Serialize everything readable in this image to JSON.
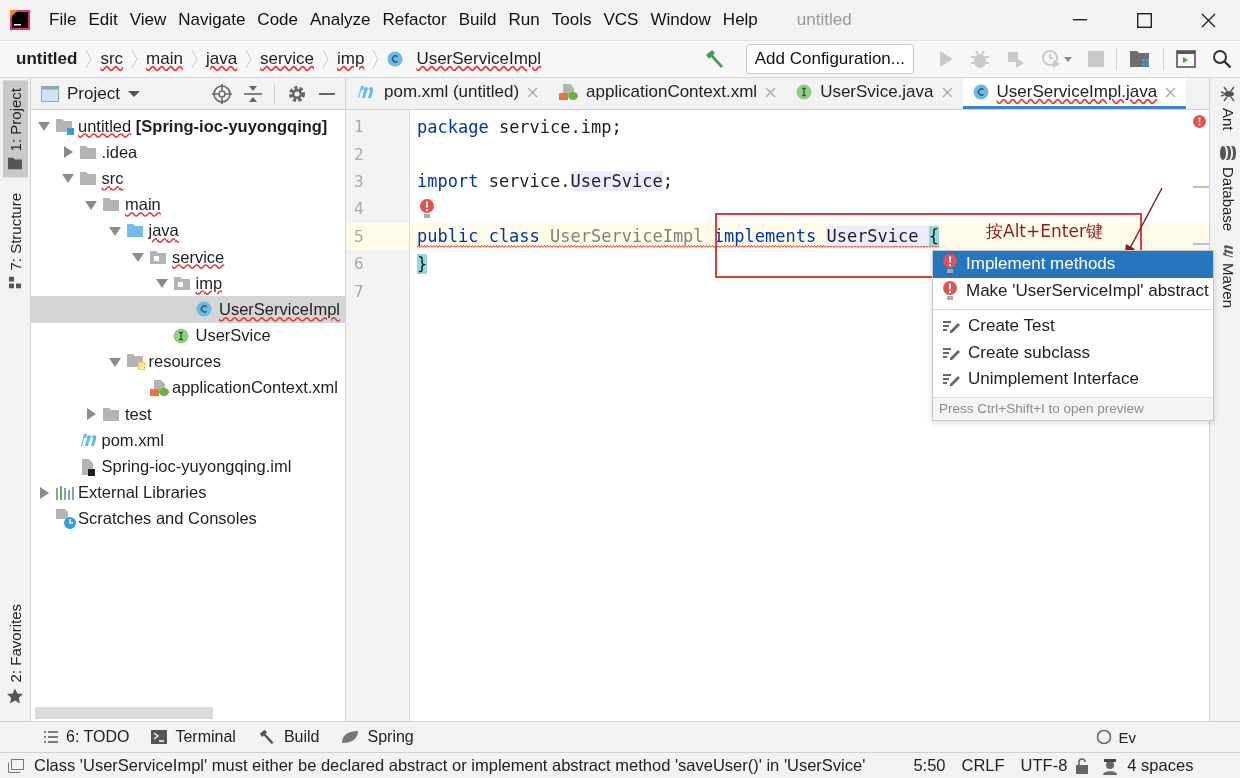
{
  "app": {
    "title": "untitled"
  },
  "menu": [
    "File",
    "Edit",
    "View",
    "Navigate",
    "Code",
    "Analyze",
    "Refactor",
    "Build",
    "Run",
    "Tools",
    "VCS",
    "Window",
    "Help"
  ],
  "breadcrumbs": [
    {
      "label": "untitled",
      "kind": "project",
      "error": false
    },
    {
      "label": "src",
      "kind": "dir",
      "error": true
    },
    {
      "label": "main",
      "kind": "dir",
      "error": true
    },
    {
      "label": "java",
      "kind": "dir",
      "error": true
    },
    {
      "label": "service",
      "kind": "dir",
      "error": true
    },
    {
      "label": "imp",
      "kind": "dir",
      "error": true
    },
    {
      "label": "UserServiceImpl",
      "kind": "class",
      "error": true
    }
  ],
  "toolbar": {
    "run_config": "Add Configuration..."
  },
  "left_stripe": [
    {
      "label": "1: Project",
      "kind": "project",
      "selected": true
    },
    {
      "label": "7: Structure",
      "kind": "structure",
      "selected": false
    },
    {
      "label": "2: Favorites",
      "kind": "favorites",
      "selected": false
    }
  ],
  "project_panel": {
    "title": "Project",
    "tree": [
      {
        "label": "untitled **[Spring-ioc-yuyongqing]**",
        "kind": "module",
        "expanded": true,
        "error": true,
        "selected": false,
        "children": [
          {
            "label": ".idea",
            "kind": "folder",
            "expanded": false,
            "error": false,
            "selected": false
          },
          {
            "label": "src",
            "kind": "folder",
            "expanded": true,
            "error": true,
            "selected": false,
            "children": [
              {
                "label": "main",
                "kind": "folder",
                "expanded": true,
                "error": true,
                "selected": false,
                "children": [
                  {
                    "label": "java",
                    "kind": "source",
                    "expanded": true,
                    "error": true,
                    "selected": false,
                    "children": [
                      {
                        "label": "service",
                        "kind": "package",
                        "expanded": true,
                        "error": true,
                        "selected": false,
                        "children": [
                          {
                            "label": "imp",
                            "kind": "package",
                            "expanded": true,
                            "error": true,
                            "selected": false,
                            "children": [
                              {
                                "label": "UserServiceImpl",
                                "kind": "class",
                                "error": true,
                                "selected": true
                              }
                            ]
                          },
                          {
                            "label": "UserSvice",
                            "kind": "interface",
                            "error": false,
                            "selected": false
                          }
                        ]
                      }
                    ]
                  },
                  {
                    "label": "resources",
                    "kind": "resources",
                    "expanded": true,
                    "error": false,
                    "selected": false,
                    "children": [
                      {
                        "label": "applicationContext.xml",
                        "kind": "xml",
                        "error": false,
                        "selected": false
                      }
                    ]
                  }
                ]
              },
              {
                "label": "test",
                "kind": "folder",
                "expanded": false,
                "error": false,
                "selected": false
              }
            ]
          },
          {
            "label": "pom.xml",
            "kind": "maven",
            "error": false,
            "selected": false
          },
          {
            "label": "Spring-ioc-yuyongqing.iml",
            "kind": "iml",
            "error": false,
            "selected": false
          }
        ]
      },
      {
        "label": "External Libraries",
        "kind": "libraries",
        "expanded": false,
        "error": false,
        "selected": false
      },
      {
        "label": "Scratches and Consoles",
        "kind": "scratches",
        "error": false,
        "selected": false
      }
    ]
  },
  "editor": {
    "tabs": [
      {
        "label": "pom.xml (untitled)",
        "kind": "maven",
        "selected": false,
        "error": false
      },
      {
        "label": "applicationContext.xml",
        "kind": "xml",
        "selected": false,
        "error": false
      },
      {
        "label": "UserSvice.java",
        "kind": "interface",
        "selected": false,
        "error": false
      },
      {
        "label": "UserServiceImpl.java",
        "kind": "class",
        "selected": true,
        "error": true
      }
    ],
    "lines": [
      {
        "number": "1",
        "current": false,
        "error": false,
        "bulb": false,
        "tokens": [
          {
            "kind": "kw",
            "text": "package"
          },
          {
            "kind": "plain",
            "text": " service.imp;"
          }
        ]
      },
      {
        "number": "2",
        "current": false,
        "error": false,
        "bulb": false
      },
      {
        "number": "3",
        "current": false,
        "error": false,
        "bulb": false,
        "tokens": [
          {
            "kind": "kw",
            "text": "import"
          },
          {
            "kind": "plain",
            "text": " service."
          },
          {
            "kind": "ref",
            "text": "UserSvice"
          },
          {
            "kind": "plain",
            "text": ";"
          }
        ]
      },
      {
        "number": "4",
        "current": false,
        "error": false,
        "bulb": true
      },
      {
        "number": "5",
        "current": true,
        "error": true,
        "bulb": false,
        "tokens": [
          {
            "kind": "kw",
            "text": "public class"
          },
          {
            "kind": "unused",
            "text": " UserServiceImpl "
          },
          {
            "kind": "kw",
            "text": "implements "
          },
          {
            "kind": "ref",
            "text": "UserSvice "
          },
          {
            "kind": "brace",
            "text": "{"
          }
        ]
      },
      {
        "number": "6",
        "current": false,
        "error": false,
        "bulb": false,
        "tokens": [
          {
            "kind": "brace",
            "text": "}"
          }
        ]
      },
      {
        "number": "7",
        "current": false,
        "error": false,
        "bulb": false
      }
    ],
    "annotation": "按Alt+Enter键",
    "popup": {
      "items": [
        {
          "label": "Implement methods",
          "kind": "error",
          "selected": true,
          "divider_before": false
        },
        {
          "label": "Make 'UserServiceImpl' abstract",
          "kind": "error",
          "selected": false,
          "divider_before": false
        },
        {
          "label": "Create Test",
          "kind": "intention",
          "selected": false,
          "divider_before": true
        },
        {
          "label": "Create subclass",
          "kind": "intention",
          "selected": false,
          "divider_before": false
        },
        {
          "label": "Unimplement Interface",
          "kind": "intention",
          "selected": false,
          "divider_before": false
        }
      ],
      "hint": "Press Ctrl+Shift+I to open preview"
    }
  },
  "right_stripe": [
    {
      "label": "Ant",
      "kind": "ant"
    },
    {
      "label": "Database",
      "kind": "database"
    },
    {
      "label": "Maven",
      "kind": "maven"
    }
  ],
  "bottom_tools": [
    {
      "label": "6: TODO",
      "kind": "todo"
    },
    {
      "label": "Terminal",
      "kind": "terminal"
    },
    {
      "label": "Build",
      "kind": "build"
    },
    {
      "label": "Spring",
      "kind": "spring"
    }
  ],
  "event_log": "Ev",
  "status": {
    "message": "Class 'UserServiceImpl' must either be declared abstract or implement abstract method 'saveUser()' in 'UserSvice'",
    "position": "5:50",
    "line_separator": "CRLF",
    "encoding": "UTF-8",
    "indent": "4 spaces"
  }
}
